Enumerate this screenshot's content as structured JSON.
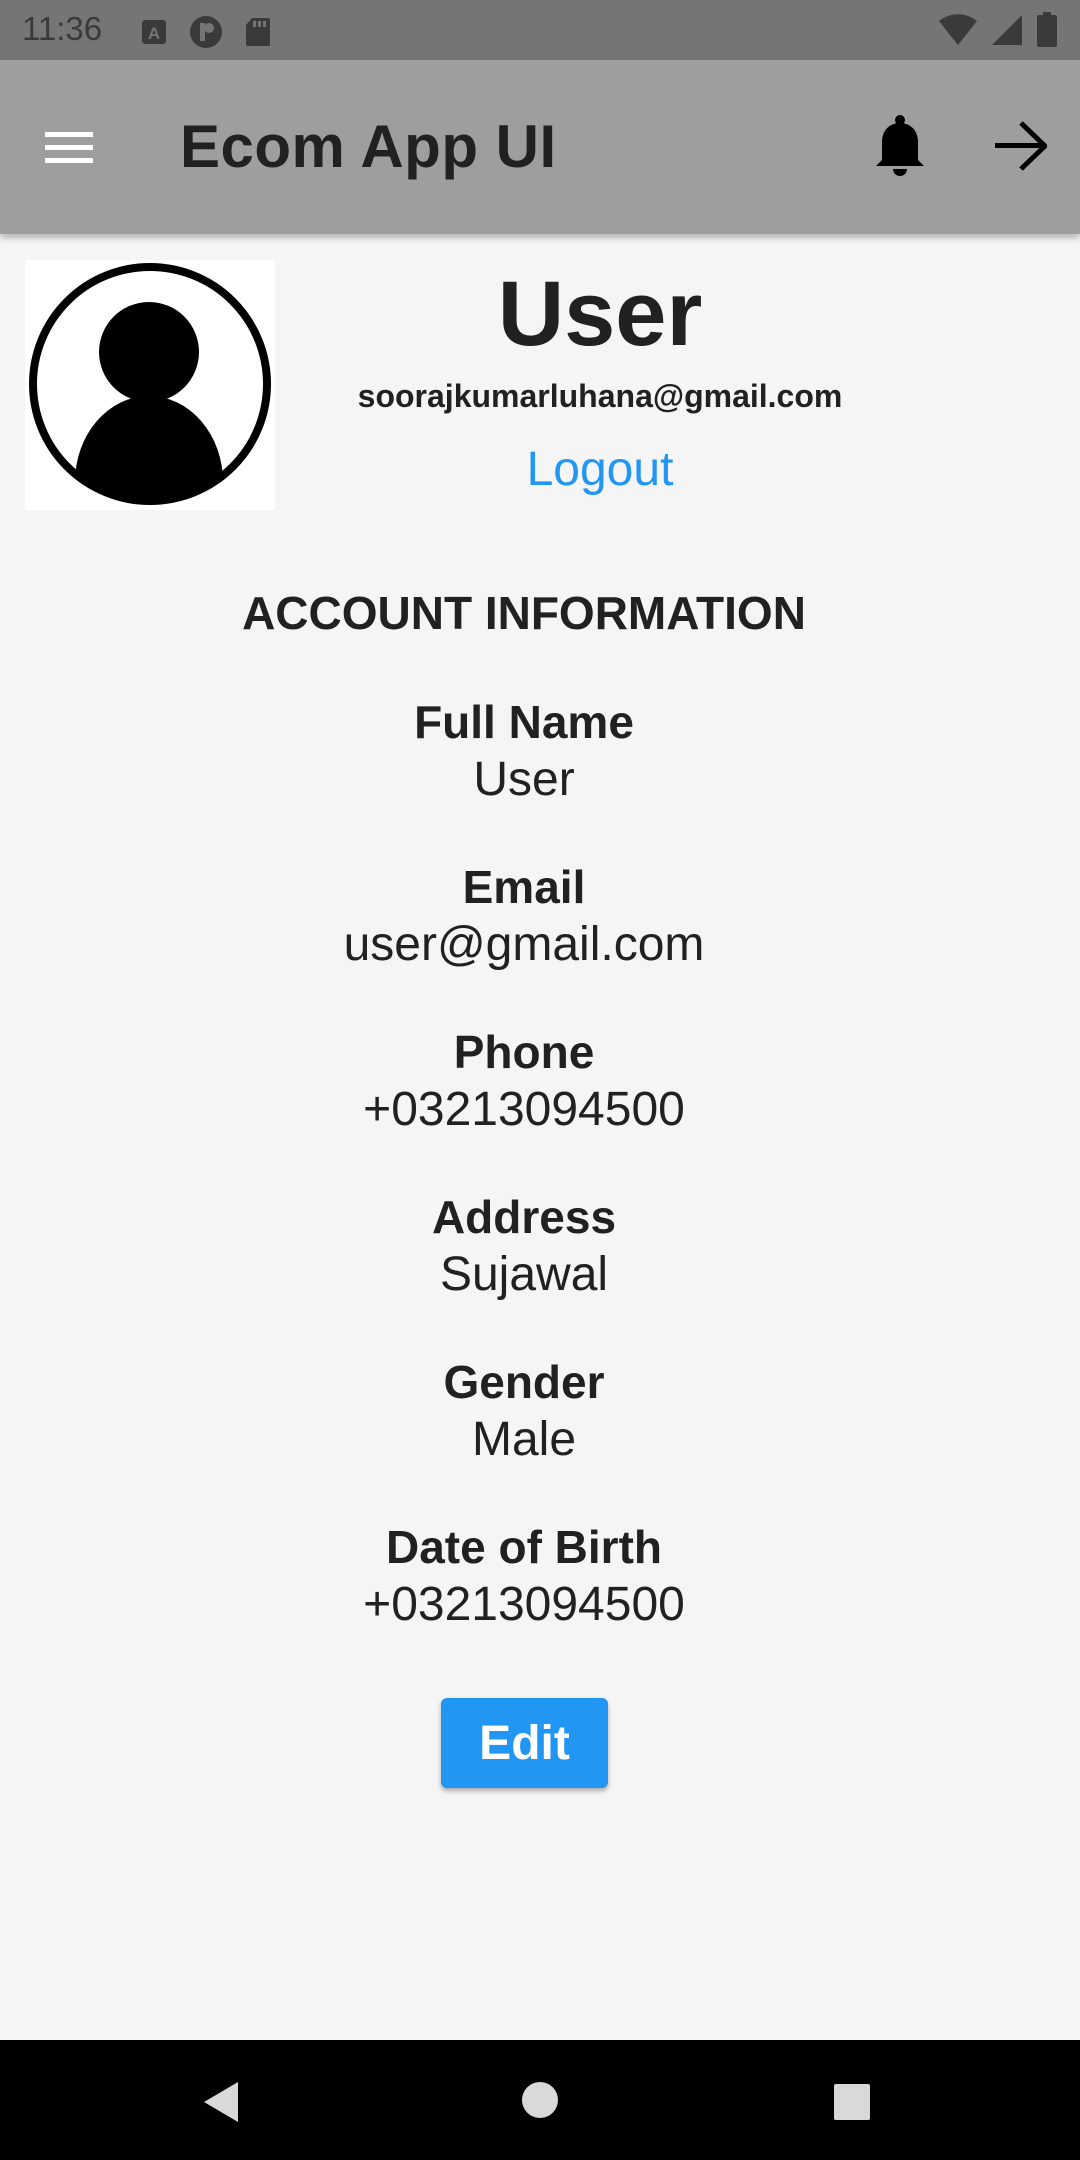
{
  "status_bar": {
    "time": "11:36",
    "left_icons": [
      "a-box-icon",
      "circle-p-icon",
      "sd-card-icon"
    ],
    "right_icons": [
      "wifi-icon",
      "signal-icon",
      "battery-icon"
    ]
  },
  "app_bar": {
    "title": "Ecom App UI",
    "menu_icon": "hamburger-menu-icon",
    "bell_icon": "bell-icon",
    "arrow_icon": "arrow-right-icon",
    "background": "#9e9e9e"
  },
  "profile": {
    "avatar_icon": "user-avatar-icon",
    "name": "User",
    "email": "soorajkumarluhana@gmail.com",
    "logout_label": "Logout"
  },
  "account": {
    "section_title": "ACCOUNT INFORMATION",
    "fields": [
      {
        "label": "Full Name",
        "value": "User"
      },
      {
        "label": "Email",
        "value": "user@gmail.com"
      },
      {
        "label": "Phone",
        "value": "+03213094500"
      },
      {
        "label": "Address",
        "value": "Sujawal"
      },
      {
        "label": "Gender",
        "value": "Male"
      },
      {
        "label": "Date of Birth",
        "value": "+03213094500"
      }
    ],
    "edit_label": "Edit"
  },
  "colors": {
    "accent": "#2196f3",
    "app_bar": "#9e9e9e",
    "status_bar": "#757575",
    "background": "#f5f5f5"
  },
  "nav_bar": {
    "icons": [
      "back-triangle-icon",
      "home-circle-icon",
      "recents-square-icon"
    ]
  }
}
